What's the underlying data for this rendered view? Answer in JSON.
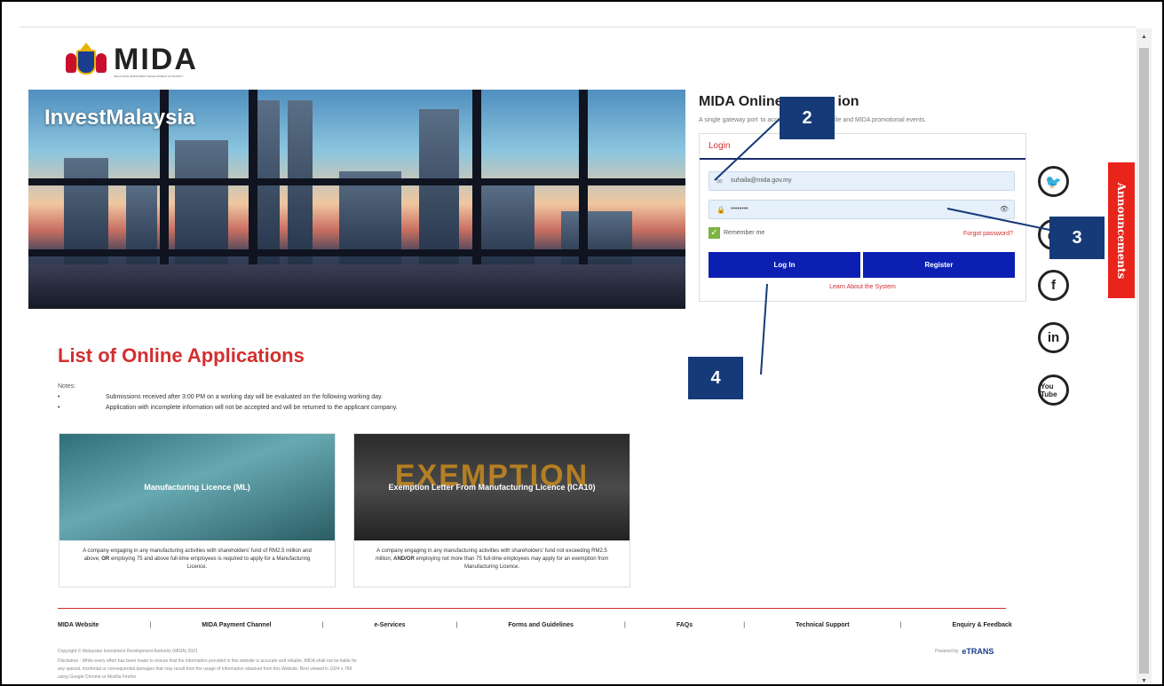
{
  "logo": {
    "text": "MIDA",
    "subtitle": "MALAYSIAN INVESTMENT DEVELOPMENT AUTHORITY"
  },
  "hero": {
    "title": "InvestMalaysia"
  },
  "portal": {
    "title": "MIDA Online",
    "title_suffix": "ion",
    "subtitle_start": "A single gateway port",
    "subtitle_mid": "to acce",
    "subtitle_end": "any profile and MIDA promotional events.",
    "login_header": "Login",
    "email_value": "suhaila@mida.gov.my",
    "password_value": "••••••••",
    "remember_label": "Remember me",
    "forgot_label": "Forgot password?",
    "login_button": "Log In",
    "register_button": "Register",
    "learn_link": "Learn About the System"
  },
  "social": {
    "twitter": "🐦",
    "instagram": "◎",
    "facebook": "f",
    "linkedin": "in",
    "youtube": "You Tube"
  },
  "announcements": "Announcements",
  "callouts": [
    "2",
    "3",
    "4"
  ],
  "list": {
    "title": "List of Online Applications",
    "notes_label": "Notes:",
    "bullet": "•",
    "notes": [
      "Submissions received after 3:00 PM on a working day will be evaluated on the following working day.",
      "Application with incomplete information will not be accepted and will be returned to the applicant company."
    ]
  },
  "cards": [
    {
      "title": "Manufacturing Licence (ML)",
      "desc_1": "A company engaging in any manufacturing activities with shareholders' fund of RM2.5 million and above;",
      "desc_or": "OR",
      "desc_2": "employing 75 and above full-time employees is required to apply for a Manufacturing Licence."
    },
    {
      "title": "Exemption Letter From Manufacturing Licence (ICA10)",
      "bg_word": "EXEMPTION",
      "desc_1": "A company engaging in any manufacturing activities with shareholders' fund not exceeding RM2.5 million;",
      "desc_or": "AND/OR",
      "desc_2": "employing not more than 75 full-time employees may apply for an exemption from Manufacturing Licence."
    }
  ],
  "footer": {
    "nav": [
      "MIDA Website",
      "MIDA Payment Channel",
      "e-Services",
      "Forms and Guidelines",
      "FAQs",
      "Technical Support",
      "Enquiry & Feedback"
    ],
    "separator": "|",
    "copyright": "Copyright © Malaysian Investment Development Authority (MIDA) 2021",
    "disclaimer": "Disclaimer : While every effort has been made to ensure that the information provided in this website is accurate and reliable, MIDA shall not be liable for any special, incidental or consequential damages that may result from the usage of information obtained from this Website. Best viewed in 1024 x 768 using Google Chrome or Mozilla Firefox.",
    "powered_by": "Powered by",
    "powered_brand": "eTRANS"
  },
  "scrollbar": {
    "up": "▲",
    "down": "▼"
  },
  "colors": {
    "accent_red": "#d32f2f",
    "button_blue": "#0b1fb3",
    "callout_navy": "#163a78",
    "announce_red": "#e8241b"
  }
}
